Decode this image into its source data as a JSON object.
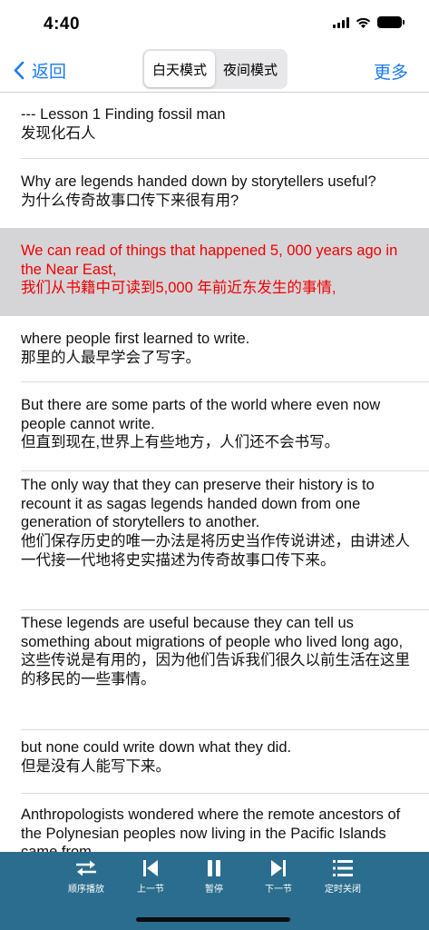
{
  "status": {
    "time": "4:40"
  },
  "nav": {
    "back_label": "返回",
    "mode_day": "白天模式",
    "mode_night": "夜间模式",
    "selected_mode": "白天模式",
    "more_label": "更多"
  },
  "colors": {
    "accent": "#1a7af8",
    "highlight_text": "#ee0000",
    "highlight_bg": "#d5d5d8",
    "player_bg": "#2b6d8e"
  },
  "sentences": [
    {
      "en": "--- Lesson 1 Finding fossil man",
      "zh": "发现化石人",
      "active": false
    },
    {
      "en": "Why are legends handed down by storytellers useful?",
      "zh": "为什么传奇故事口传下来很有用?",
      "active": false
    },
    {
      "en": "We can read of things that happened 5, 000 years ago in the Near East,",
      "zh": "我们从书籍中可读到5,000 年前近东发生的事情,",
      "active": true
    },
    {
      "en": "where people first learned to write.",
      "zh": "那里的人最早学会了写字。",
      "active": false
    },
    {
      "en": "But there are some parts of the world where even now people cannot write.",
      "zh": "但直到现在,世界上有些地方，人们还不会书写。",
      "active": false
    },
    {
      "en": "The only way that they can preserve their history is to recount it as sagas legends handed down from one generation of storytellers to another.",
      "zh": "他们保存历史的唯一办法是将历史当作传说讲述，由讲述人一代接一代地将史实描述为传奇故事口传下来。",
      "active": false
    },
    {
      "en": "These legends are useful because they can tell us something about migrations of people who lived long ago,",
      "zh": "这些传说是有用的，因为他们告诉我们很久以前生活在这里的移民的一些事情。",
      "active": false
    },
    {
      "en": "but none could write down what they did.",
      "zh": "但是没有人能写下来。",
      "active": false
    },
    {
      "en": "Anthropologists wondered where the remote ancestors of the Polynesian peoples now living in the Pacific Islands came from.",
      "zh": "",
      "active": false
    }
  ],
  "player": {
    "order_label": "顺序播放",
    "prev_label": "上一节",
    "pause_label": "暂停",
    "next_label": "下一节",
    "timer_label": "定时关闭",
    "icons": [
      "shuffle-arrows-icon",
      "skip-back-icon",
      "pause-icon",
      "skip-forward-icon",
      "list-icon"
    ]
  }
}
